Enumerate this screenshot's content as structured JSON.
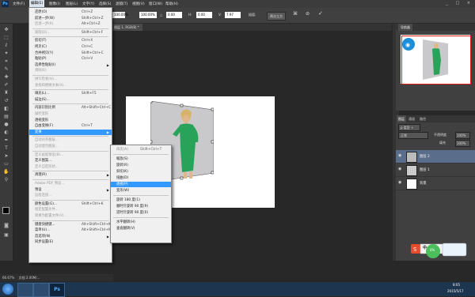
{
  "app": {
    "logo": "Ps"
  },
  "menubar": {
    "items": [
      "文件(F)",
      "编辑(E)",
      "图像(I)",
      "图层(L)",
      "文字(Y)",
      "选择(S)",
      "滤镜(T)",
      "视图(V)",
      "窗口(W)",
      "帮助(H)"
    ],
    "active": "编辑(E)"
  },
  "optbar": {
    "w": "100.00%",
    "h": "100.00%",
    "angle": "0.00",
    "hskew": "0.00",
    "vskew": "7.97",
    "interp": "两次立方"
  },
  "edit_menu": {
    "items": [
      {
        "label": "还原(O)",
        "shortcut": "Ctrl+Z"
      },
      {
        "label": "前进一步(W)",
        "shortcut": "Shift+Ctrl+Z"
      },
      {
        "label": "后退一步(K)",
        "shortcut": "Alt+Ctrl+Z"
      },
      {
        "label": "渐隐(D)...",
        "shortcut": "Shift+Ctrl+F"
      },
      {
        "label": "剪切(T)",
        "shortcut": "Ctrl+X"
      },
      {
        "label": "拷贝(C)",
        "shortcut": "Ctrl+C"
      },
      {
        "label": "合并拷贝(Y)",
        "shortcut": "Shift+Ctrl+C"
      },
      {
        "label": "粘贴(P)",
        "shortcut": "Ctrl+V"
      },
      {
        "label": "选择性粘贴(I)",
        "shortcut": ""
      },
      {
        "label": "清除(E)",
        "shortcut": ""
      },
      {
        "label": "拼写检查(H)...",
        "shortcut": ""
      },
      {
        "label": "查找和替换文本(X)...",
        "shortcut": ""
      },
      {
        "label": "填充(L)...",
        "shortcut": "Shift+F5"
      },
      {
        "label": "描边(S)...",
        "shortcut": ""
      },
      {
        "label": "内容识别比例",
        "shortcut": "Alt+Shift+Ctrl+C"
      },
      {
        "label": "操控变形",
        "shortcut": ""
      },
      {
        "label": "透视变形",
        "shortcut": ""
      },
      {
        "label": "自由变换(F)",
        "shortcut": "Ctrl+T"
      },
      {
        "label": "变换",
        "shortcut": ""
      },
      {
        "label": "自动对齐图层...",
        "shortcut": ""
      },
      {
        "label": "自动混合图层...",
        "shortcut": ""
      },
      {
        "label": "定义画笔预设(B)...",
        "shortcut": ""
      },
      {
        "label": "定义图案...",
        "shortcut": ""
      },
      {
        "label": "定义自定形状...",
        "shortcut": ""
      },
      {
        "label": "清理(R)",
        "shortcut": ""
      },
      {
        "label": "Adobe PDF 预设...",
        "shortcut": ""
      },
      {
        "label": "预设",
        "shortcut": ""
      },
      {
        "label": "远程连接...",
        "shortcut": ""
      },
      {
        "label": "颜色设置(G)...",
        "shortcut": "Shift+Ctrl+K"
      },
      {
        "label": "指定配置文件...",
        "shortcut": ""
      },
      {
        "label": "转换为配置文件(V)...",
        "shortcut": ""
      },
      {
        "label": "键盘快捷键...",
        "shortcut": "Alt+Shift+Ctrl+K"
      },
      {
        "label": "菜单(U)...",
        "shortcut": "Alt+Shift+Ctrl+M"
      },
      {
        "label": "首选项(N)",
        "shortcut": ""
      },
      {
        "label": "同步设置(E)",
        "shortcut": ""
      }
    ]
  },
  "transform_menu": {
    "items": [
      {
        "label": "再次(A)",
        "shortcut": "Shift+Ctrl+T"
      },
      {
        "label": "缩放(S)",
        "shortcut": ""
      },
      {
        "label": "旋转(R)",
        "shortcut": ""
      },
      {
        "label": "斜切(K)",
        "shortcut": ""
      },
      {
        "label": "扭曲(D)",
        "shortcut": ""
      },
      {
        "label": "透视(P)",
        "shortcut": ""
      },
      {
        "label": "变形(W)",
        "shortcut": ""
      },
      {
        "label": "旋转 180 度(1)",
        "shortcut": ""
      },
      {
        "label": "顺时针旋转 90 度(9)",
        "shortcut": ""
      },
      {
        "label": "逆时针旋转 90 度(0)",
        "shortcut": ""
      },
      {
        "label": "水平翻转(H)",
        "shortcut": ""
      },
      {
        "label": "垂直翻转(V)",
        "shortcut": ""
      }
    ]
  },
  "tab": {
    "title": "图层 1, RGB/8) *"
  },
  "navigator": {
    "tab": "导航器"
  },
  "layers": {
    "tabs": [
      "图层",
      "通道",
      "路径"
    ],
    "blend": "正常",
    "opacity_label": "不透明度",
    "opacity": "100%",
    "fill_label": "填充",
    "fill": "100%",
    "rows": [
      {
        "name": "图层 2"
      },
      {
        "name": "图层 1"
      },
      {
        "name": "背景"
      }
    ]
  },
  "status": {
    "zoom": "66.67%",
    "doc": "文档:3.00M/..."
  },
  "taskbar": {
    "time": "8:05",
    "date": "2015/5/17"
  },
  "sogou": {
    "label": "中",
    "pct": "0%"
  },
  "colors": {
    "accent": "#3399ff",
    "menubg": "#f0f0f0",
    "dress": "#29a35a"
  }
}
